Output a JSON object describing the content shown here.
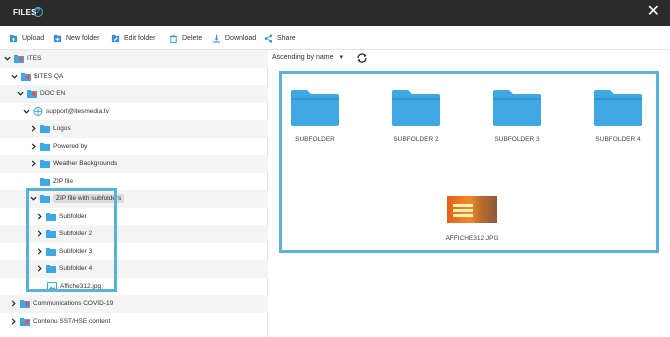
{
  "header": {
    "title": "FILES",
    "help_icon": "help-icon",
    "close_icon": "close-icon"
  },
  "toolbar": {
    "upload": "Upload",
    "new_folder": "New folder",
    "edit_folder": "Edit folder",
    "delete": "Delete",
    "download": "Download",
    "share": "Share"
  },
  "tree": {
    "items": [
      {
        "label": "ITES"
      },
      {
        "label": "$ITES QA"
      },
      {
        "label": "DOC EN"
      },
      {
        "label": "support@itesmedia.tv"
      },
      {
        "label": "Logos"
      },
      {
        "label": "Powered by"
      },
      {
        "label": "Weather Backgrounds"
      },
      {
        "label": "ZIP file"
      },
      {
        "label": "ZIP file with subfolders"
      },
      {
        "label": "Subfolder"
      },
      {
        "label": "Subfolder 2"
      },
      {
        "label": "Subfolder 3"
      },
      {
        "label": "Subfolder 4"
      },
      {
        "label": "Affiche312.jpg"
      },
      {
        "label": "Communications COVID-19"
      },
      {
        "label": "Contenu SST/HSE content"
      }
    ]
  },
  "sort": {
    "selected": "Ascending by name"
  },
  "content": {
    "folders": [
      {
        "label": "SUBFOLDER"
      },
      {
        "label": "SUBFOLDER 2"
      },
      {
        "label": "SUBFOLDER 3"
      },
      {
        "label": "SUBFOLDER 4"
      }
    ],
    "image_label": "AFFICHE312.JPG"
  },
  "colors": {
    "accent": "#5db0dc",
    "folder": "#3fa7e1",
    "titlebar": "#2b2b2b"
  }
}
